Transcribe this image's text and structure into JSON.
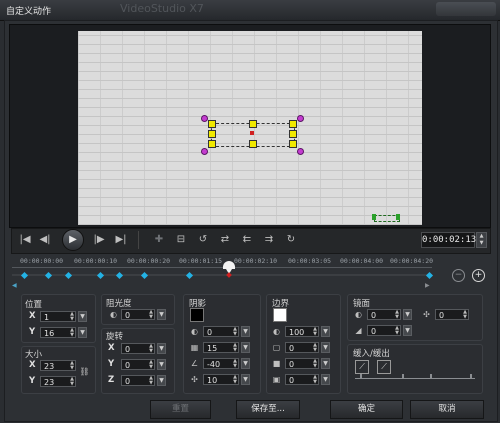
{
  "window": {
    "title": "自定义动作",
    "ghost_title": "VideoStudio X7"
  },
  "playback": {
    "timecode": "0:00:02:13",
    "buttons": {
      "home": "|◀",
      "prev": "◀|",
      "play": "▶",
      "next": "|▶",
      "end": "▶|"
    }
  },
  "timeline": {
    "ticks": [
      "00:00:00:00",
      "00:00:00:10",
      "00:00:00:20",
      "00:00:01:15",
      "00:00:02:10",
      "00:00:03:05",
      "00:00:04:00",
      "00:00:04:20"
    ]
  },
  "position": {
    "label": "位置",
    "x_label": "X",
    "x": "1",
    "y_label": "Y",
    "y": "16"
  },
  "size": {
    "label": "大小",
    "x_label": "X",
    "x": "23",
    "y_label": "Y",
    "y": "23"
  },
  "opacity": {
    "label": "阻光度",
    "value": "0"
  },
  "rotation": {
    "label": "旋转",
    "x_label": "X",
    "x": "0",
    "y_label": "Y",
    "y": "0",
    "z_label": "Z",
    "z": "0"
  },
  "shadow": {
    "label": "阴影",
    "color": "#000000",
    "opacity": "0",
    "blur": "15",
    "angle": "-40",
    "distance": "10"
  },
  "border": {
    "label": "边界",
    "color": "#ffffff",
    "opacity": "100",
    "width": "0",
    "field3": "0",
    "field4": "0"
  },
  "mirror": {
    "label": "镜面",
    "opacity": "0",
    "offset": "0",
    "distance": "0"
  },
  "fade": {
    "label": "缓入/缓出"
  },
  "footer": {
    "reset": "重置",
    "save_as": "保存至...",
    "ok": "确定",
    "cancel": "取消"
  },
  "colors": {
    "accent": "#23b2e4",
    "handle": "#f1e900",
    "pivot": "#c43cd0",
    "playhead": "#d02020"
  }
}
